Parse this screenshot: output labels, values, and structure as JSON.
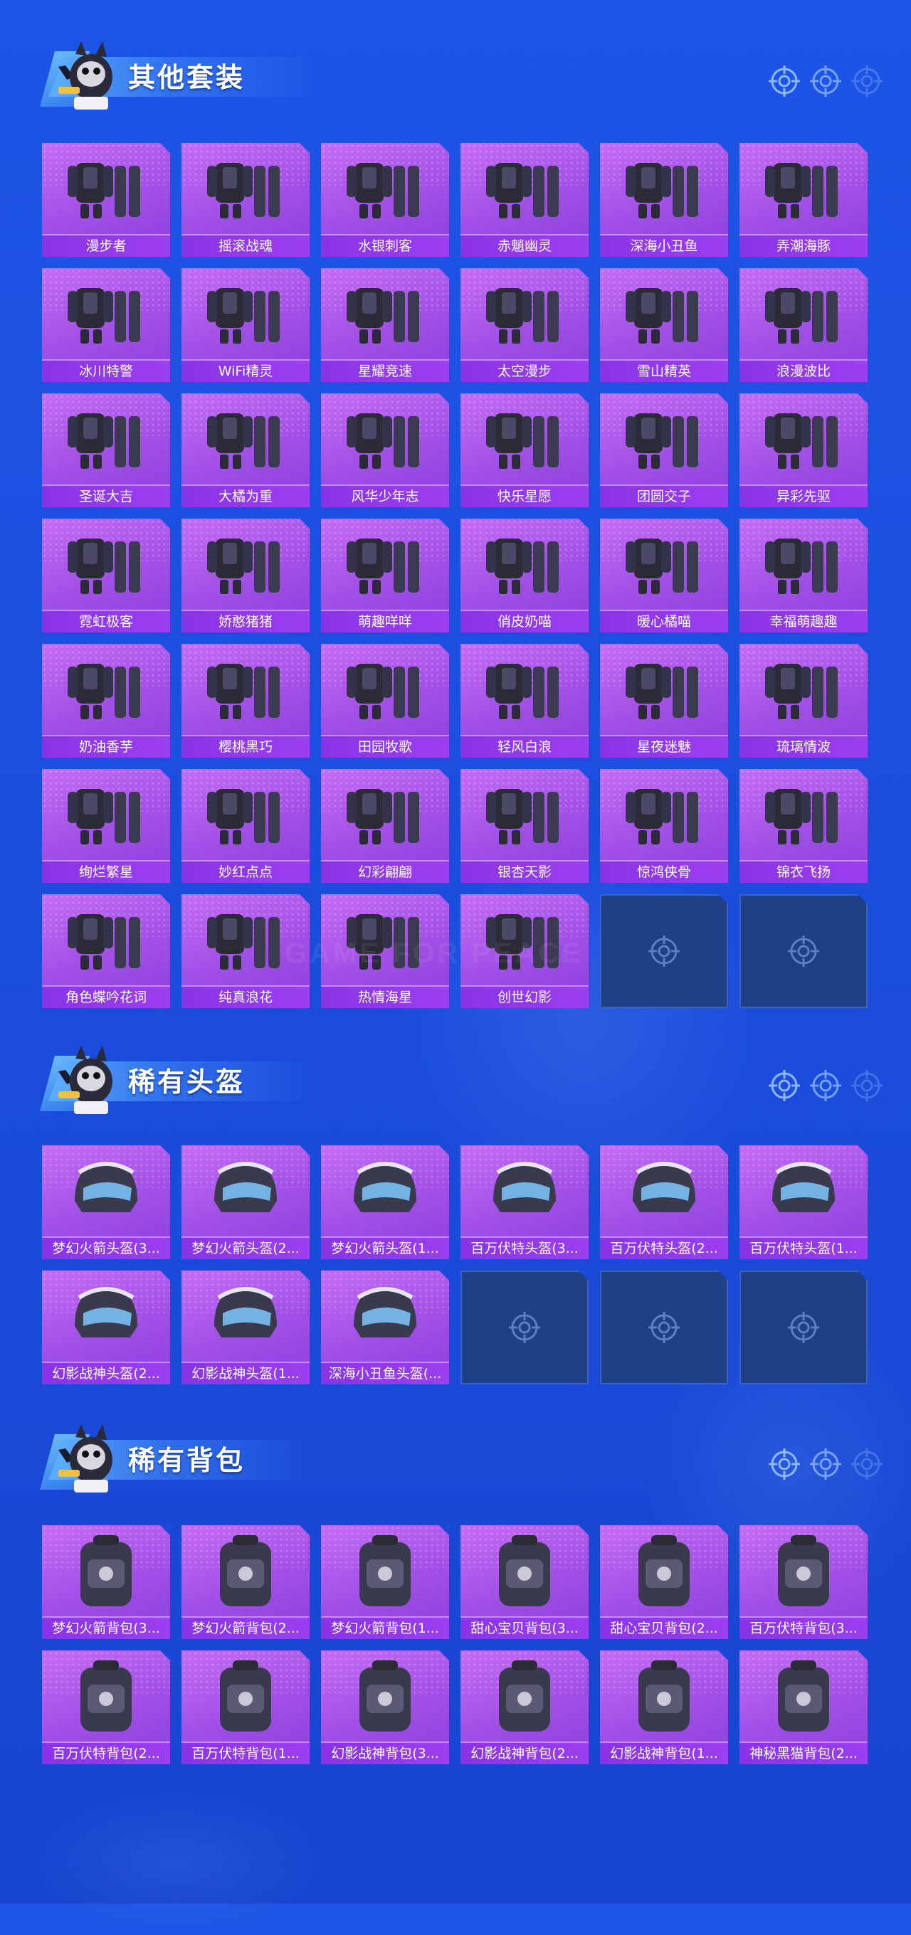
{
  "colors": {
    "background": "#1c4fe0",
    "card": "#a04fe6",
    "card_label": "#8a33e6",
    "empty_slot": "#1f3f86",
    "title_text": "#ffffff"
  },
  "sections": [
    {
      "title": "其他套装",
      "rows": 7,
      "items": [
        {
          "label": "漫步者",
          "icon": "outfit-icon"
        },
        {
          "label": "摇滚战魂",
          "icon": "outfit-icon"
        },
        {
          "label": "水银刺客",
          "icon": "outfit-icon"
        },
        {
          "label": "赤魈幽灵",
          "icon": "outfit-icon"
        },
        {
          "label": "深海小丑鱼",
          "icon": "outfit-icon"
        },
        {
          "label": "弄潮海豚",
          "icon": "outfit-icon"
        },
        {
          "label": "冰川特警",
          "icon": "outfit-icon"
        },
        {
          "label": "WiFi精灵",
          "icon": "outfit-icon"
        },
        {
          "label": "星耀竞速",
          "icon": "outfit-icon"
        },
        {
          "label": "太空漫步",
          "icon": "outfit-icon"
        },
        {
          "label": "雪山精英",
          "icon": "outfit-icon"
        },
        {
          "label": "浪漫波比",
          "icon": "outfit-icon"
        },
        {
          "label": "圣诞大吉",
          "icon": "outfit-icon"
        },
        {
          "label": "大橘为重",
          "icon": "outfit-icon"
        },
        {
          "label": "风华少年志",
          "icon": "outfit-icon"
        },
        {
          "label": "快乐星愿",
          "icon": "outfit-icon"
        },
        {
          "label": "团圆交子",
          "icon": "outfit-icon"
        },
        {
          "label": "异彩先驱",
          "icon": "outfit-icon"
        },
        {
          "label": "霓虹极客",
          "icon": "outfit-icon"
        },
        {
          "label": "娇憨猪猪",
          "icon": "outfit-icon"
        },
        {
          "label": "萌趣咩咩",
          "icon": "outfit-icon"
        },
        {
          "label": "俏皮奶喵",
          "icon": "outfit-icon"
        },
        {
          "label": "暖心橘喵",
          "icon": "outfit-icon"
        },
        {
          "label": "幸福萌趣趣",
          "icon": "outfit-icon"
        },
        {
          "label": "奶油香芋",
          "icon": "outfit-icon"
        },
        {
          "label": "樱桃黑巧",
          "icon": "outfit-icon"
        },
        {
          "label": "田园牧歌",
          "icon": "outfit-icon"
        },
        {
          "label": "轻风白浪",
          "icon": "outfit-icon"
        },
        {
          "label": "星夜迷魅",
          "icon": "outfit-icon"
        },
        {
          "label": "琉璃情波",
          "icon": "outfit-icon"
        },
        {
          "label": "绚烂繁星",
          "icon": "outfit-icon"
        },
        {
          "label": "妙红点点",
          "icon": "outfit-icon"
        },
        {
          "label": "幻彩翩翩",
          "icon": "outfit-icon"
        },
        {
          "label": "银杏天影",
          "icon": "outfit-icon"
        },
        {
          "label": "惊鸿侠骨",
          "icon": "outfit-icon"
        },
        {
          "label": "锦衣飞扬",
          "icon": "outfit-icon"
        },
        {
          "label": "角色蝶吟花词",
          "icon": "outfit-icon"
        },
        {
          "label": "纯真浪花",
          "icon": "outfit-icon"
        },
        {
          "label": "热情海星",
          "icon": "outfit-icon"
        },
        {
          "label": "创世幻影",
          "icon": "outfit-icon"
        }
      ]
    },
    {
      "title": "稀有头盔",
      "rows": 2,
      "items": [
        {
          "label": "梦幻火箭头盔(3...",
          "icon": "helmet-icon"
        },
        {
          "label": "梦幻火箭头盔(2...",
          "icon": "helmet-icon"
        },
        {
          "label": "梦幻火箭头盔(1...",
          "icon": "helmet-icon"
        },
        {
          "label": "百万伏特头盔(3...",
          "icon": "helmet-icon"
        },
        {
          "label": "百万伏特头盔(2...",
          "icon": "helmet-icon"
        },
        {
          "label": "百万伏特头盔(1...",
          "icon": "helmet-icon"
        },
        {
          "label": "幻影战神头盔(2...",
          "icon": "helmet-icon"
        },
        {
          "label": "幻影战神头盔(1...",
          "icon": "helmet-icon"
        },
        {
          "label": "深海小丑鱼头盔(...",
          "icon": "helmet-icon"
        }
      ]
    },
    {
      "title": "稀有背包",
      "rows": 2,
      "items": [
        {
          "label": "梦幻火箭背包(3...",
          "icon": "backpack-icon"
        },
        {
          "label": "梦幻火箭背包(2...",
          "icon": "backpack-icon"
        },
        {
          "label": "梦幻火箭背包(1...",
          "icon": "backpack-icon"
        },
        {
          "label": "甜心宝贝背包(3...",
          "icon": "backpack-icon"
        },
        {
          "label": "甜心宝贝背包(2...",
          "icon": "backpack-icon"
        },
        {
          "label": "百万伏特背包(3...",
          "icon": "backpack-icon"
        },
        {
          "label": "百万伏特背包(2...",
          "icon": "backpack-icon"
        },
        {
          "label": "百万伏特背包(1...",
          "icon": "backpack-icon"
        },
        {
          "label": "幻影战神背包(3...",
          "icon": "backpack-icon"
        },
        {
          "label": "幻影战神背包(2...",
          "icon": "backpack-icon"
        },
        {
          "label": "幻影战神背包(1...",
          "icon": "backpack-icon"
        },
        {
          "label": "神秘黑猫背包(2...",
          "icon": "backpack-icon"
        }
      ]
    }
  ]
}
